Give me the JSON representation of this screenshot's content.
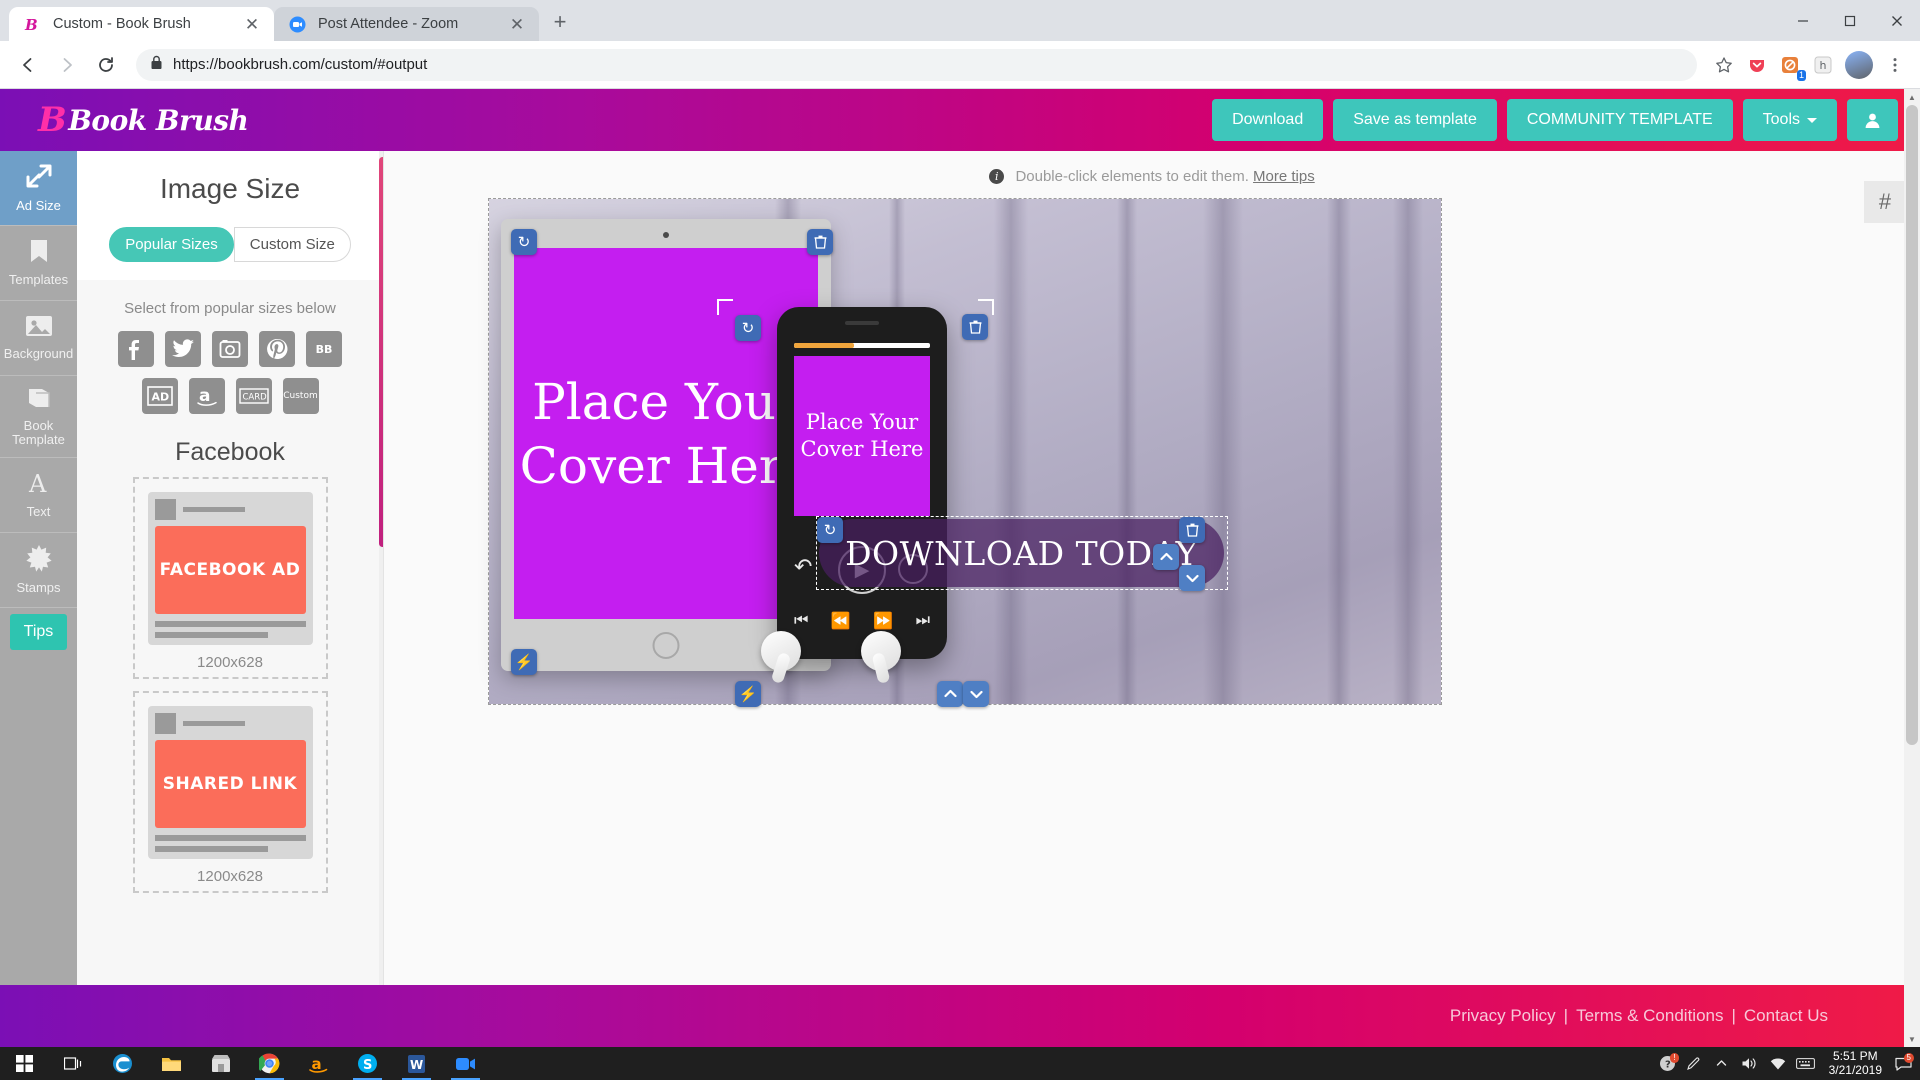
{
  "browser": {
    "tabs": [
      {
        "title": "Custom - Book Brush",
        "favicon": "bookbrush-icon",
        "active": true
      },
      {
        "title": "Post Attendee - Zoom",
        "favicon": "zoom-icon",
        "active": false
      }
    ],
    "new_tab_label": "+",
    "window_controls": {
      "minimize": "—",
      "maximize": "❐",
      "close": "✕"
    },
    "nav": {
      "back": "←",
      "forward": "→",
      "reload": "⟳"
    },
    "omnibox": {
      "lock": "lock-icon",
      "url_prefix": "https://",
      "url_main": "bookbrush.com/custom",
      "url_suffix": "/#output",
      "full_url": "https://bookbrush.com/custom/#output"
    },
    "toolbar_icons": [
      "star-icon",
      "extension-icon",
      "adblock-icon",
      "pocket-icon"
    ],
    "adblock_count": "1",
    "menu": "⋮"
  },
  "app": {
    "logo_text": "Book Brush",
    "header_buttons": [
      {
        "label": "Download",
        "name": "download-button"
      },
      {
        "label": "Save as template",
        "name": "save-as-template-button"
      },
      {
        "label": "COMMUNITY TEMPLATE",
        "name": "community-template-button"
      },
      {
        "label": "Tools",
        "name": "tools-dropdown",
        "caret": true
      }
    ],
    "account_button": "☺"
  },
  "rail": {
    "items": [
      {
        "label": "Ad Size",
        "icon": "resize-arrows-icon",
        "active": true
      },
      {
        "label": "Templates",
        "icon": "bookmark-icon",
        "active": false
      },
      {
        "label": "Background",
        "icon": "image-icon",
        "active": false
      },
      {
        "label": "Book Template",
        "icon": "book-icon",
        "active": false
      },
      {
        "label": "Text",
        "icon": "letter-a-icon",
        "active": false
      },
      {
        "label": "Stamps",
        "icon": "starburst-icon",
        "active": false
      }
    ],
    "tips_label": "Tips"
  },
  "panel": {
    "title": "Image Size",
    "tabs": [
      {
        "label": "Popular Sizes",
        "selected": true
      },
      {
        "label": "Custom Size",
        "selected": false
      }
    ],
    "subtitle": "Select from popular sizes below",
    "platform_icons": [
      {
        "glyph": "f",
        "name": "facebook-icon",
        "size": "lg"
      },
      {
        "glyph": "🐦",
        "name": "twitter-icon",
        "size": "lg"
      },
      {
        "glyph": "▣",
        "name": "instagram-icon",
        "size": "lg"
      },
      {
        "glyph": "р",
        "name": "pinterest-icon",
        "size": "lg"
      },
      {
        "glyph": "BB",
        "name": "bookbub-icon",
        "size": "sm"
      },
      {
        "glyph": "AD",
        "name": "ad-icon",
        "size": "sm"
      },
      {
        "glyph": "a",
        "name": "amazon-icon",
        "size": "lg"
      },
      {
        "glyph": "CARD",
        "name": "card-icon",
        "size": "xs"
      },
      {
        "glyph": "Custom",
        "name": "custom-icon",
        "size": "xs"
      }
    ],
    "group_title": "Facebook",
    "cards": [
      {
        "hero_label": "FACEBOOK AD",
        "caption": "1200x628"
      },
      {
        "hero_label": "SHARED LINK",
        "caption": "1200x628"
      }
    ]
  },
  "canvas": {
    "tip_text": "Double-click elements to edit them.",
    "tip_link": "More tips",
    "tip_icon": "info-icon",
    "hash_button": "#",
    "cover_text": "Place Your Cover Here",
    "banner_text": "DOWNLOAD TODAY",
    "handles": {
      "rotate": "↻",
      "delete": "🗑",
      "bolt": "⚡",
      "up": "⌃",
      "down": "⌄"
    }
  },
  "footer": {
    "links": [
      "Privacy Policy",
      "Terms & Conditions",
      "Contact Us"
    ],
    "separator": "|"
  },
  "taskbar": {
    "start": "start-button",
    "task_view": "task-view-icon",
    "apps": [
      {
        "name": "edge-icon",
        "glyph": "e",
        "color": "#1a8fd0",
        "running": false
      },
      {
        "name": "file-explorer-icon",
        "glyph": "📁",
        "color": "#f5c242",
        "running": false
      },
      {
        "name": "store-icon",
        "glyph": "🛎",
        "color": "#d8d8d8",
        "running": false
      },
      {
        "name": "chrome-icon",
        "glyph": "●",
        "color": "#4285f4",
        "running": true
      },
      {
        "name": "amazon-icon",
        "glyph": "a",
        "color": "#ff9900",
        "running": false
      },
      {
        "name": "skype-icon",
        "glyph": "S",
        "color": "#00aff0",
        "running": true
      },
      {
        "name": "word-icon",
        "glyph": "W",
        "color": "#2b579a",
        "running": true
      },
      {
        "name": "zoom-icon",
        "glyph": "▶",
        "color": "#2d8cff",
        "running": true
      }
    ],
    "tray": {
      "help_badge": "!",
      "pen_icon": "pen-icon",
      "chevron_icon": "show-hidden-icon",
      "speaker_icon": "volume-icon",
      "network_icon": "network-icon",
      "keyboard_icon": "keyboard-icon",
      "time": "5:51 PM",
      "date": "3/21/2019",
      "notification_icon": "action-center-icon",
      "notification_count": "5"
    }
  }
}
